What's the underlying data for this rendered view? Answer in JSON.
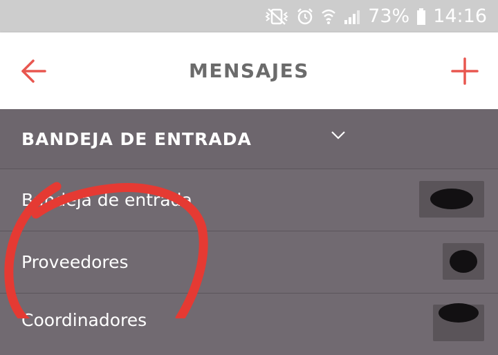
{
  "status_bar": {
    "battery": "73%",
    "time": "14:16",
    "icons": [
      "mute-vibrate-icon",
      "alarm-icon",
      "wifi-icon",
      "signal-icon",
      "battery-icon"
    ]
  },
  "header": {
    "title": "MENSAJES",
    "back_icon": "arrow-left-icon",
    "add_icon": "plus-icon",
    "accent_color": "#e8564f"
  },
  "section": {
    "label": "BANDEJA DE ENTRADA",
    "icon": "chevron-down-icon"
  },
  "items": [
    {
      "label": "Bandeja de entrada"
    },
    {
      "label": "Proveedores"
    },
    {
      "label": "Coordinadores"
    }
  ],
  "colors": {
    "status_bar": "#cdcdcd",
    "header_bg": "#ffffff",
    "list_bg": "#716a71",
    "annotation_red": "#e53a33"
  }
}
